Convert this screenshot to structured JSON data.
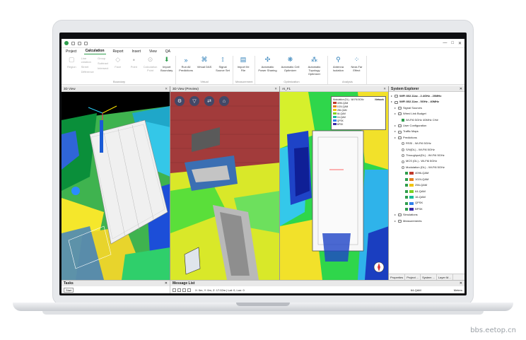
{
  "app": {
    "menu": [
      "Project",
      "Calculation",
      "Report",
      "Insert",
      "View",
      "QA"
    ],
    "active_menu": "Calculation",
    "window_controls": [
      "—",
      "□",
      "✕"
    ]
  },
  "ribbon": {
    "groups": [
      {
        "name": "Boundary",
        "items": [
          {
            "label": "Region",
            "disabled": true
          },
          {
            "label": "Face",
            "disabled": true
          },
          {
            "label": "Point",
            "disabled": true
          },
          {
            "label": "Calculation Point",
            "disabled": true
          },
          {
            "label": "Import Boundary",
            "disabled": false
          }
        ],
        "small": [
          "Line creation",
          "Street",
          "Difference",
          "Group",
          "Subtract",
          "Intersect"
        ]
      },
      {
        "name": "Virtual",
        "items": [
          {
            "label": "Run All Predictions",
            "disabled": false
          },
          {
            "label": "Virtual DAS",
            "disabled": false
          },
          {
            "label": "Signal Source Set",
            "disabled": false
          }
        ]
      },
      {
        "name": "Measurement",
        "items": [
          {
            "label": "Import Ibi File",
            "disabled": false
          }
        ]
      },
      {
        "name": "Optimization",
        "items": [
          {
            "label": "Automatic Power Sharing",
            "disabled": false
          },
          {
            "label": "Automatic Cell Optimizer",
            "disabled": false
          },
          {
            "label": "Automatic Topology Optimizer",
            "disabled": false
          }
        ]
      },
      {
        "name": "Analysis",
        "items": [
          {
            "label": "Antenna Isolation",
            "disabled": false
          },
          {
            "label": "Near-Far Effect",
            "disabled": false
          }
        ]
      }
    ]
  },
  "views": [
    {
      "tab": "3D View",
      "close": "✕"
    },
    {
      "tab": "3D View (Preview)",
      "close": "✕"
    },
    {
      "tab": "AI_F1",
      "close": "✕"
    }
  ],
  "explorer": {
    "title": "System Explorer",
    "close": "✕",
    "tree": [
      {
        "level": 0,
        "label": "WiFi 802.11ac - 2.4GHz - 20MHz",
        "bold": true,
        "icon": "wifi-icon"
      },
      {
        "level": 0,
        "label": "WiFi 802.11ax - 5GHz - 40MHz",
        "bold": true,
        "icon": "wifi-icon"
      },
      {
        "level": 1,
        "label": "Signal Sources",
        "icon": "folder-icon"
      },
      {
        "level": 1,
        "label": "Wired Link Budget",
        "icon": "folder-icon"
      },
      {
        "level": 2,
        "label": "Wi-Fi6 5GHz 40MHz CH#",
        "icon": "check-icon"
      },
      {
        "level": 1,
        "label": "User Configuration",
        "icon": "folder-icon"
      },
      {
        "level": 1,
        "label": "Traffic Maps",
        "icon": "folder-icon"
      },
      {
        "level": 1,
        "label": "Predictions",
        "icon": "folder-icon"
      },
      {
        "level": 2,
        "label": "RSSI - Wi-Fi6 5GHz",
        "icon": "radio-icon"
      },
      {
        "level": 2,
        "label": "S/N(DL) - Wi-Fi6 5GHz",
        "icon": "radio-icon"
      },
      {
        "level": 2,
        "label": "Throughput(DL) - Wi-Fi6 5GHz",
        "icon": "radio-icon"
      },
      {
        "level": 2,
        "label": "MCS (DL) - Wi-Fi6 5GHz",
        "icon": "radio-icon"
      },
      {
        "level": 2,
        "label": "Modulation (DL) - Wi-Fi6 5GHz",
        "icon": "radio-icon"
      },
      {
        "level": 3,
        "label": "4096-QAM",
        "color": "#c0392b"
      },
      {
        "level": 3,
        "label": "1024-QAM",
        "color": "#e67e22"
      },
      {
        "level": 3,
        "label": "256-QAM",
        "color": "#f1c40f"
      },
      {
        "level": 3,
        "label": "64-QAM",
        "color": "#7ed321"
      },
      {
        "level": 3,
        "label": "16-QAM",
        "color": "#1abc9c"
      },
      {
        "level": 3,
        "label": "QPSK",
        "color": "#2f80ed"
      },
      {
        "level": 3,
        "label": "BPSK",
        "color": "#3b2aa8"
      },
      {
        "level": 1,
        "label": "Simulations",
        "icon": "folder-icon"
      },
      {
        "level": 1,
        "label": "Measurements",
        "icon": "folder-icon"
      }
    ],
    "tabs": [
      "Properties",
      "Project ...",
      "System ...",
      "Layer M..."
    ]
  },
  "bottom": {
    "tasks_title": "Tasks",
    "tasks_button": "Start",
    "message_title": "Message List",
    "coords": "X: 0m, Y: 0m, Z: 17.02m | Lat: 0, Lon: 0",
    "mod_value": "64-QAM",
    "units": "Meters",
    "close": "✕"
  },
  "legend_popup": {
    "title": "Network",
    "items": [
      "Modulation (DL) - Wi-Fi6 5GHz",
      "4096-QAM",
      "1024-QAM",
      "256-QAM",
      "64-QAM",
      "16-QAM",
      "QPSK",
      "BPSK"
    ]
  },
  "watermark": "bbs.eetop.cn"
}
